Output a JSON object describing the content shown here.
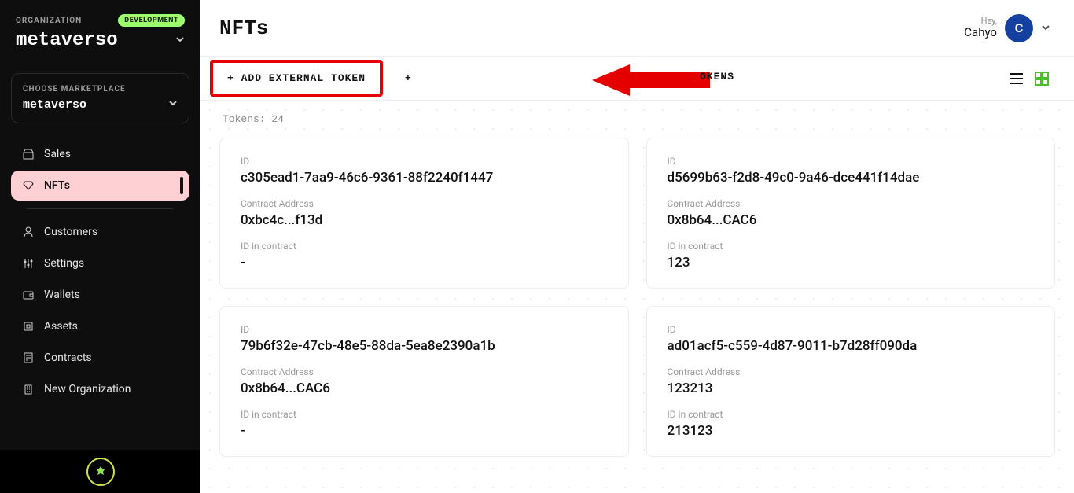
{
  "sidebar": {
    "org_label": "ORGANIZATION",
    "env_badge": "DEVELOPMENT",
    "org_name": "metaverso",
    "marketplace_label": "CHOOSE MARKETPLACE",
    "marketplace_name": "metaverso",
    "items": [
      {
        "icon": "store-icon",
        "label": "Sales",
        "active": false
      },
      {
        "icon": "diamond-icon",
        "label": "NFTs",
        "active": true
      },
      {
        "sep": true
      },
      {
        "icon": "person-icon",
        "label": "Customers",
        "active": false
      },
      {
        "icon": "sliders-icon",
        "label": "Settings",
        "active": false
      },
      {
        "icon": "wallet-icon",
        "label": "Wallets",
        "active": false
      },
      {
        "icon": "layers-icon",
        "label": "Assets",
        "active": false
      },
      {
        "icon": "contract-icon",
        "label": "Contracts",
        "active": false
      },
      {
        "icon": "building-icon",
        "label": "New Organization",
        "active": false
      }
    ]
  },
  "header": {
    "title": "NFTs",
    "greeting": "Hey,",
    "user_name": "Cahyo",
    "avatar_letter": "C"
  },
  "actions": {
    "add_external_token": "+ ADD EXTERNAL TOKEN",
    "plus_fragment": "+",
    "obscured_suffix": "OKENS"
  },
  "content": {
    "count_label": "Tokens:",
    "count_value": "24",
    "field_labels": {
      "id": "ID",
      "addr": "Contract Address",
      "cid": "ID in contract"
    },
    "cards": [
      {
        "id": "c305ead1-7aa9-46c6-9361-88f2240f1447",
        "addr": "0xbc4c...f13d",
        "cid": "-"
      },
      {
        "id": "d5699b63-f2d8-49c0-9a46-dce441f14dae",
        "addr": "0x8b64...CAC6",
        "cid": "123"
      },
      {
        "id": "79b6f32e-47cb-48e5-88da-5ea8e2390a1b",
        "addr": "0x8b64...CAC6",
        "cid": "-"
      },
      {
        "id": "ad01acf5-c559-4d87-9011-b7d28ff090da",
        "addr": "123213",
        "cid": "213123"
      }
    ]
  },
  "annotation": {
    "type": "highlight-arrow",
    "target": "add-external-token-button",
    "description": "Red box around ADD EXTERNAL TOKEN with red arrow pointing left toward it"
  }
}
